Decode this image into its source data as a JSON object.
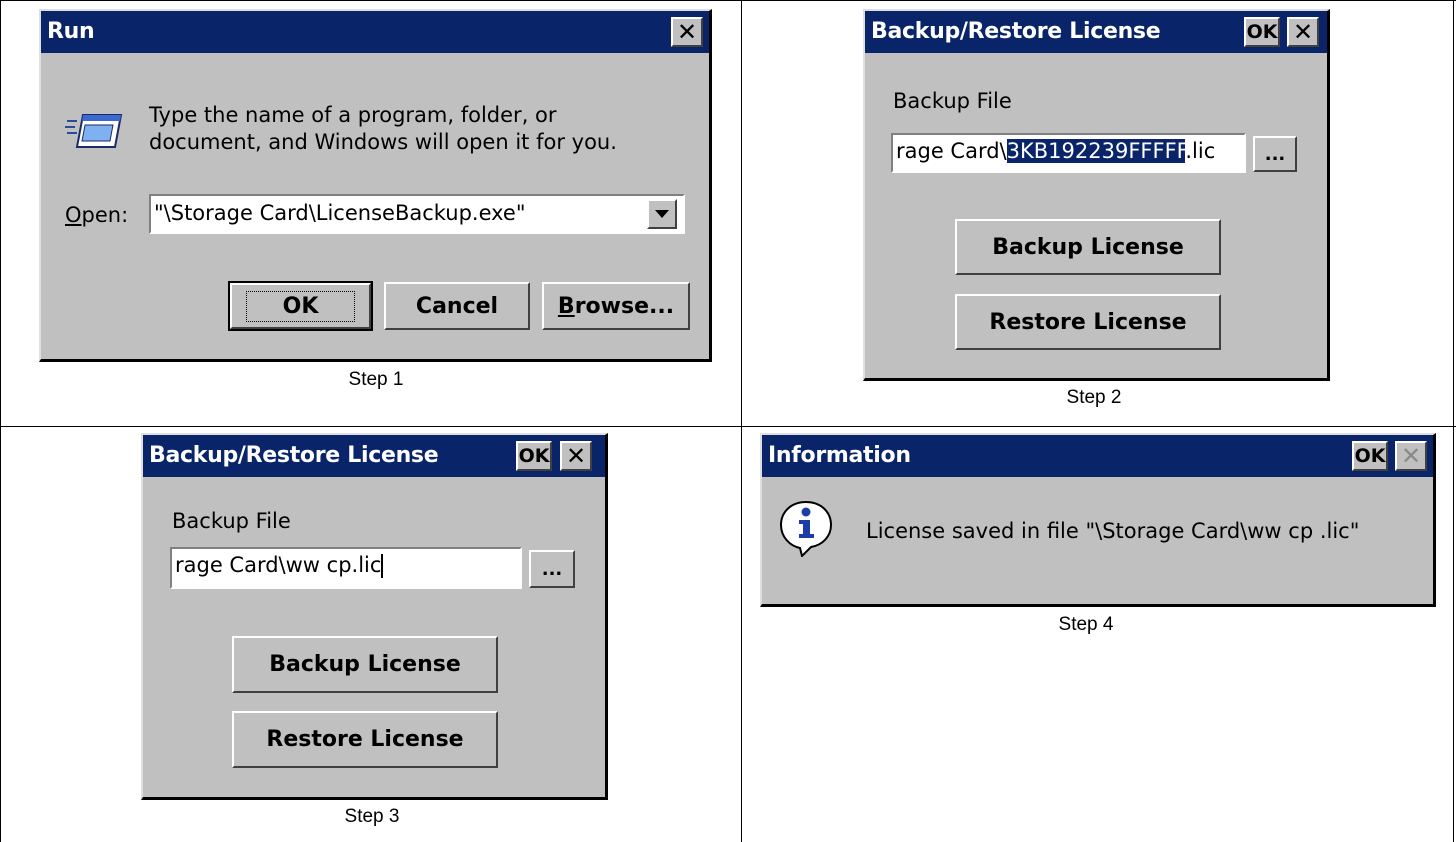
{
  "captions": {
    "step1": "Step 1",
    "step2": "Step 2",
    "step3": "Step 3",
    "step4": "Step 4"
  },
  "run_dialog": {
    "title": "Run",
    "close_label": "✕",
    "description_line1": "Type the name of a program, folder, or",
    "description_line2": "document, and Windows will open it for you.",
    "open_label_prefix": "O",
    "open_label_rest": "pen:",
    "open_value": "\"\\Storage Card\\LicenseBackup.exe\"",
    "ok_label": "OK",
    "cancel_label": "Cancel",
    "browse_label_prefix": "B",
    "browse_label_rest": "rowse...",
    "icon": "run-program-icon"
  },
  "backup_dialog_step2": {
    "title": "Backup/Restore License",
    "ok_label": "OK",
    "close_label": "✕",
    "backup_file_label": "Backup File",
    "file_value_before": "rage Card\\",
    "file_value_selected": "3KB192239FFFFF",
    "file_value_after": ".lic",
    "browse_label": "...",
    "backup_button": "Backup License",
    "restore_button": "Restore License"
  },
  "backup_dialog_step3": {
    "title": "Backup/Restore License",
    "ok_label": "OK",
    "close_label": "✕",
    "backup_file_label": "Backup File",
    "file_value": "rage Card\\ww cp.lic",
    "browse_label": "...",
    "backup_button": "Backup License",
    "restore_button": "Restore License"
  },
  "info_dialog": {
    "title": "Information",
    "ok_label": "OK",
    "close_label": "✕",
    "message": "License saved in file \"\\Storage Card\\ww cp .lic\"",
    "icon": "information-icon"
  },
  "colors": {
    "titlebar": "#0a246a",
    "dialog_face": "#c0c0c0",
    "selection": "#0a246a"
  }
}
